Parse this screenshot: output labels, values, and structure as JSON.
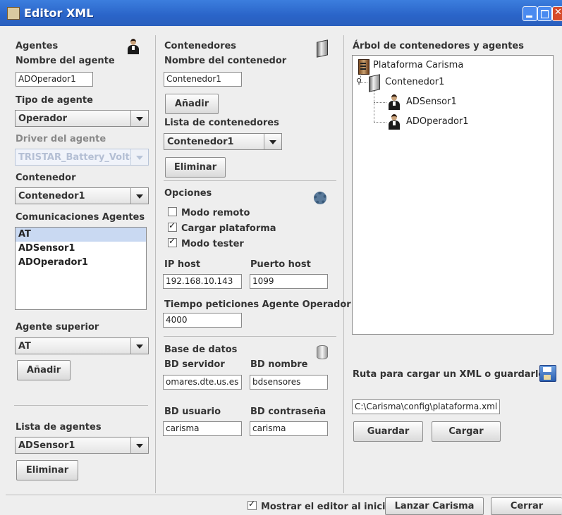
{
  "window": {
    "title": "Editor XML"
  },
  "agentes": {
    "heading": "Agentes",
    "name_label": "Nombre del agente",
    "name_value": "ADOperador1",
    "type_label": "Tipo de agente",
    "type_value": "Operador",
    "driver_label": "Driver del agente",
    "driver_value": "TRISTAR_Battery_Volta...",
    "container_label": "Contenedor",
    "container_value": "Contenedor1",
    "comms_label": "Comunicaciones Agentes",
    "comms_items": [
      "AT",
      "ADSensor1",
      "ADOperador1"
    ],
    "superior_label": "Agente superior",
    "superior_value": "AT",
    "add_button": "Añadir",
    "list_label": "Lista de agentes",
    "list_value": "ADSensor1",
    "remove_button": "Eliminar"
  },
  "contenedores": {
    "heading": "Contenedores",
    "name_label": "Nombre del contenedor",
    "name_value": "Contenedor1",
    "add_button": "Añadir",
    "list_label": "Lista de contenedores",
    "list_value": "Contenedor1",
    "remove_button": "Eliminar"
  },
  "opciones": {
    "heading": "Opciones",
    "remote_label": "Modo remoto",
    "remote_checked": false,
    "load_label": "Cargar plataforma",
    "load_checked": true,
    "tester_label": "Modo tester",
    "tester_checked": true,
    "ip_label": "IP host",
    "ip_value": "192.168.10.143",
    "port_label": "Puerto host",
    "port_value": "1099",
    "time_label": "Tiempo peticiones Agente Operador",
    "time_value": "4000"
  },
  "basedatos": {
    "heading": "Base de datos",
    "server_label": "BD servidor",
    "server_value": "omares.dte.us.es",
    "name_label": "BD nombre",
    "name_value": "bdsensores",
    "user_label": "BD usuario",
    "user_value": "carisma",
    "pass_label": "BD contraseña",
    "pass_value": "carisma"
  },
  "arbol": {
    "heading": "Árbol de contenedores y agentes",
    "root": "Plataforma Carisma",
    "container": "Contenedor1",
    "agents": [
      "ADSensor1",
      "ADOperador1"
    ]
  },
  "ruta": {
    "label": "Ruta para cargar un XML o guardarlo",
    "value": "C:\\Carisma\\config\\plataforma.xml",
    "save_button": "Guardar",
    "load_button": "Cargar"
  },
  "footer": {
    "show_label": "Mostrar el editor al inicio",
    "show_checked": true,
    "launch_button": "Lanzar Carisma",
    "close_button": "Cerrar"
  },
  "colors": {
    "titlebar": "#2a64c8",
    "selection": "#c9d9f2",
    "background": "#eeeeee"
  }
}
